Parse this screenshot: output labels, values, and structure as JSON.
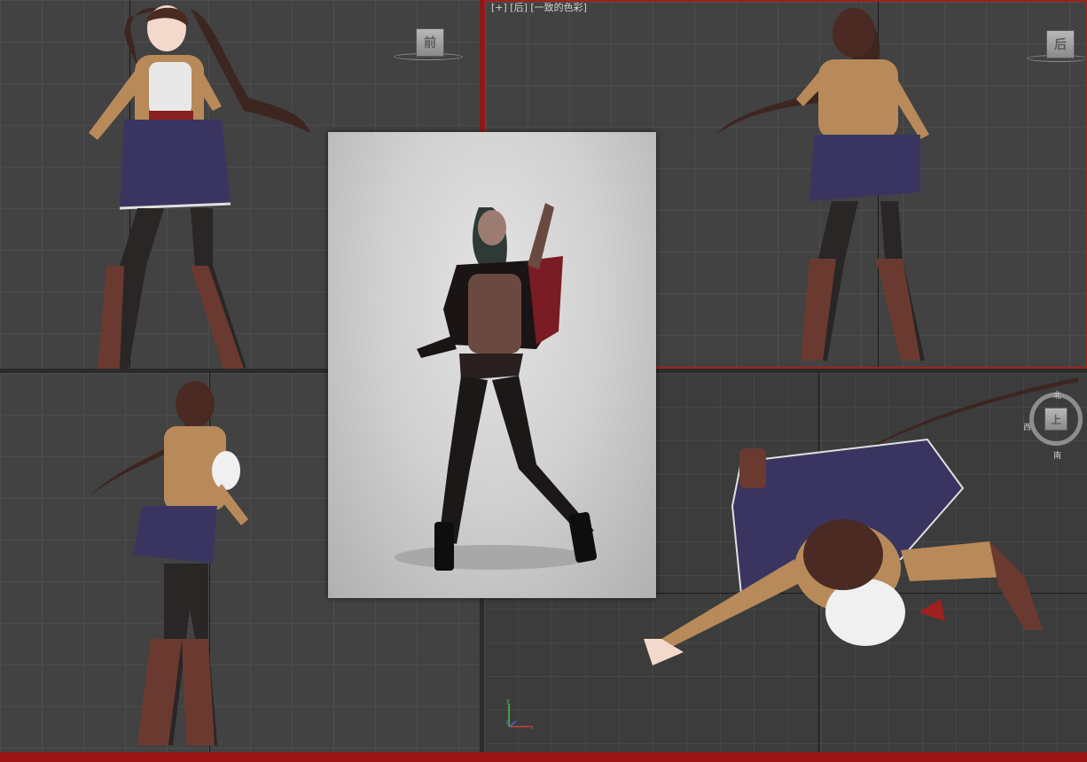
{
  "viewports": {
    "top_left": {
      "label": "",
      "cube_text": "前"
    },
    "top_right": {
      "label": "[+] [后] [一致的色彩]",
      "cube_text": "后"
    },
    "bottom_left": {
      "label": ""
    },
    "bottom_right": {
      "label": "",
      "cube_text": "上",
      "compass": {
        "north": "北",
        "south": "南",
        "west": "西"
      },
      "axis_labels": {
        "x": "x",
        "y": "y",
        "z": "z"
      }
    }
  },
  "colors": {
    "viewport_bg": "#424242",
    "active_border": "#a21f1f",
    "status_bar": "#9c1414"
  },
  "icons": [
    "view-cube-icon",
    "compass-icon",
    "axis-tripod-icon"
  ]
}
